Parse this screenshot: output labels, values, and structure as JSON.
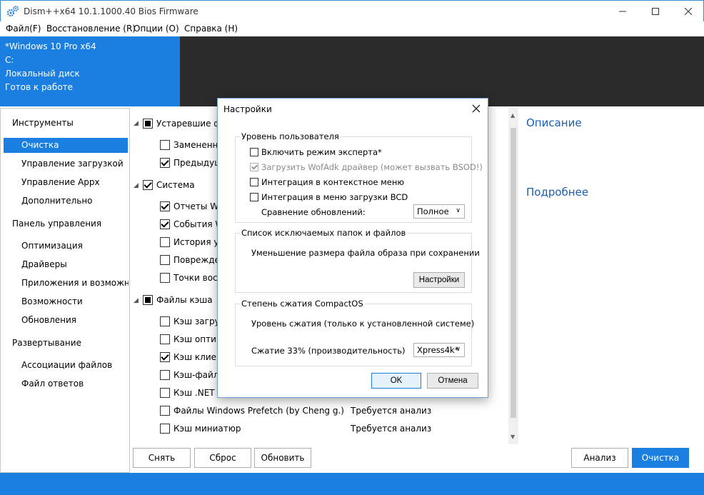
{
  "window": {
    "title": "Dism++x64 10.1.1000.40 Bios Firmware",
    "minimize": "—",
    "maximize": "☐",
    "close": "✕"
  },
  "menu": {
    "items": [
      "Файл(F)",
      "Восстановление (R)",
      "Опции (O)",
      "Справка (H)"
    ]
  },
  "os_info": {
    "lines": [
      "*Windows 10 Pro x64",
      "C:",
      "Локальный диск",
      "Готов к работе"
    ]
  },
  "nav": {
    "sections": [
      {
        "label": "Инструменты",
        "items": [
          "Очистка",
          "Управление загрузкой",
          "Управление Appx",
          "Дополнительно"
        ]
      },
      {
        "label": "Панель управления",
        "items": [
          "Оптимизация",
          "Драйверы",
          "Приложения и возможнос",
          "Возможности",
          "Обновления"
        ]
      },
      {
        "label": "Развертывание",
        "items": [
          "Ассоциации файлов",
          "Файл ответов"
        ]
      }
    ],
    "selected": "Очистка"
  },
  "list": {
    "groups": [
      {
        "label": "Устаревшие фа",
        "state": "tri",
        "items": [
          {
            "label": "Замененн",
            "state": "unchecked",
            "status": ""
          },
          {
            "label": "Предыдущ",
            "state": "checked",
            "status": ""
          }
        ]
      },
      {
        "label": "Система",
        "state": "checked",
        "items": [
          {
            "label": "Отчеты Win",
            "state": "checked",
            "status": ""
          },
          {
            "label": "События W",
            "state": "checked",
            "status": ""
          },
          {
            "label": "История ус",
            "state": "unchecked",
            "status": ""
          },
          {
            "label": "Поврежден",
            "state": "unchecked",
            "status": ""
          },
          {
            "label": "Точки восс",
            "state": "unchecked",
            "status": ""
          }
        ]
      },
      {
        "label": "Файлы кэша",
        "state": "tri",
        "items": [
          {
            "label": "Кэш загруз",
            "state": "unchecked",
            "status": ""
          },
          {
            "label": "Кэш оптим",
            "state": "unchecked",
            "status": ""
          },
          {
            "label": "Кэш клиент",
            "state": "checked",
            "status": ""
          },
          {
            "label": "Кэш-файль",
            "state": "unchecked",
            "status": ""
          },
          {
            "label": "Кэш .NET с",
            "state": "unchecked",
            "status": ""
          },
          {
            "label": "Файлы Windows Prefetch (by Cheng g.)",
            "state": "unchecked",
            "status": "Требуется анализ"
          },
          {
            "label": "Кэш миниатюр",
            "state": "unchecked",
            "status": "Требуется анализ"
          }
        ]
      }
    ]
  },
  "right": {
    "description_title": "Описание",
    "more_title": "Подробнее"
  },
  "bottom_buttons": {
    "uncheck": "Снять",
    "reset": "Сброс",
    "refresh": "Обновить",
    "analyze": "Анализ",
    "clean": "Очистка"
  },
  "dialog": {
    "title": "Настройки",
    "user_level": {
      "title": "Уровень пользователя",
      "options": [
        {
          "label": "Включить режим эксперта*",
          "checked": false,
          "disabled": false
        },
        {
          "label": "Загрузить WofAdk драйвер (может вызвать BSOD!)",
          "checked": true,
          "disabled": true
        },
        {
          "label": "Интеграция в контекстное меню",
          "checked": false,
          "disabled": false
        },
        {
          "label": "Интеграция в меню загрузки BCD",
          "checked": false,
          "disabled": false
        }
      ],
      "compare_label": "Сравнение обновлений:",
      "compare_value": "Полное"
    },
    "exclusions": {
      "title": "Список исключаемых папок и файлов",
      "text": "Уменьшение размера файла образа при сохранении",
      "button": "Настройки"
    },
    "compact": {
      "title": "Степень сжатия CompactOS",
      "text": "Уровень сжатия (только к установленной системе)",
      "ratio_label": "Сжатие 33% (производительность)",
      "ratio_value": "Xpress4k*"
    },
    "ok": "OK",
    "cancel": "Отмена"
  }
}
